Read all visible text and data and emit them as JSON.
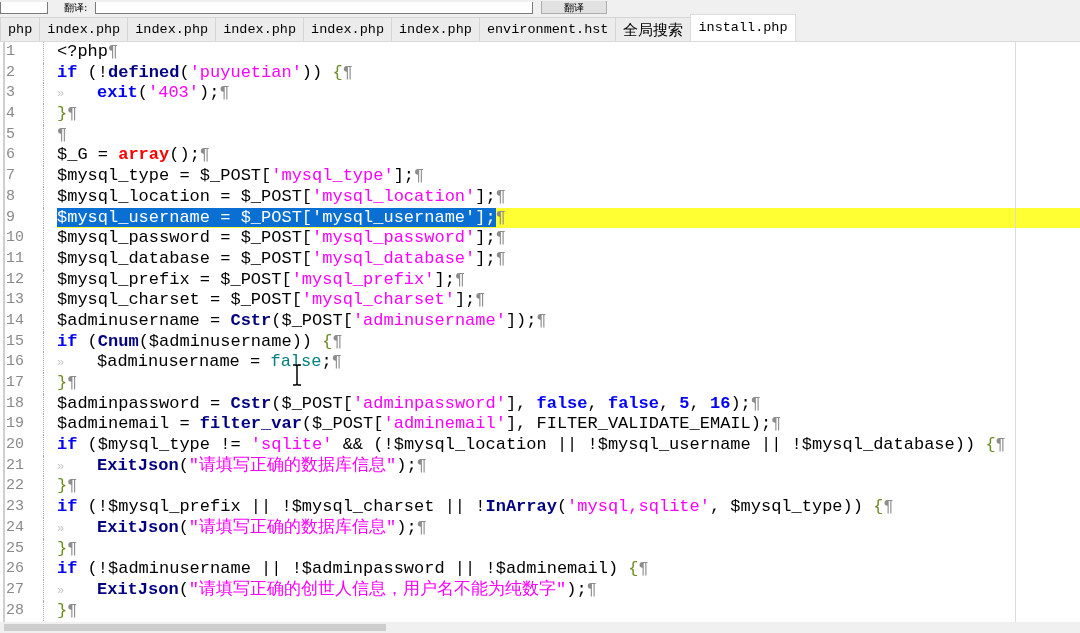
{
  "toolbar": {
    "label": "翻译:",
    "button": "翻译"
  },
  "tabs": [
    {
      "label": "php",
      "selected": false
    },
    {
      "label": "index.php",
      "selected": false
    },
    {
      "label": "index.php",
      "selected": false
    },
    {
      "label": "index.php",
      "selected": false
    },
    {
      "label": "index.php",
      "selected": false
    },
    {
      "label": "index.php",
      "selected": false
    },
    {
      "label": "environment.hst",
      "selected": false
    },
    {
      "label": "全局搜索",
      "selected": false
    },
    {
      "label": "install.php",
      "selected": true
    }
  ],
  "editor": {
    "lines": [
      {
        "number": "1",
        "current": false,
        "selected": false,
        "tokens": [
          {
            "kind": "plain",
            "text": "<?php"
          }
        ],
        "eol": "¶"
      },
      {
        "number": "2",
        "current": false,
        "selected": false,
        "tokens": [
          {
            "kind": "kw",
            "text": "if"
          },
          {
            "kind": "plain",
            "text": " (!"
          },
          {
            "kind": "fn",
            "text": "defined"
          },
          {
            "kind": "plain",
            "text": "("
          },
          {
            "kind": "str",
            "text": "'puyuetian'"
          },
          {
            "kind": "plain",
            "text": ")) "
          },
          {
            "kind": "brace",
            "text": "{"
          }
        ],
        "eol": "¶"
      },
      {
        "number": "3",
        "current": false,
        "selected": false,
        "tokens": [
          {
            "kind": "tab",
            "text": "»"
          },
          {
            "kind": "kw",
            "text": "exit"
          },
          {
            "kind": "plain",
            "text": "("
          },
          {
            "kind": "str",
            "text": "'403'"
          },
          {
            "kind": "plain",
            "text": ");"
          }
        ],
        "eol": "¶"
      },
      {
        "number": "4",
        "current": false,
        "selected": false,
        "tokens": [
          {
            "kind": "brace",
            "text": "}"
          }
        ],
        "eol": "¶"
      },
      {
        "number": "5",
        "current": false,
        "selected": false,
        "eol": "¶"
      },
      {
        "number": "6",
        "current": false,
        "selected": false,
        "tokens": [
          {
            "kind": "plain",
            "text": "$_G = "
          },
          {
            "kind": "red",
            "text": "array"
          },
          {
            "kind": "plain",
            "text": "();"
          }
        ],
        "eol": "¶"
      },
      {
        "number": "7",
        "current": false,
        "selected": false,
        "tokens": [
          {
            "kind": "plain",
            "text": "$mysql_type = $_POST["
          },
          {
            "kind": "str",
            "text": "'mysql_type'"
          },
          {
            "kind": "plain",
            "text": "];"
          }
        ],
        "eol": "¶"
      },
      {
        "number": "8",
        "current": false,
        "selected": false,
        "tokens": [
          {
            "kind": "plain",
            "text": "$mysql_location = $_POST["
          },
          {
            "kind": "str",
            "text": "'mysql_location'"
          },
          {
            "kind": "plain",
            "text": "];"
          }
        ],
        "eol": "¶"
      },
      {
        "number": "9",
        "current": true,
        "selected": true,
        "tokens": [
          {
            "kind": "plain",
            "text": "$mysql_username = $_POST["
          },
          {
            "kind": "str",
            "text": "'mysql_username'"
          },
          {
            "kind": "plain",
            "text": "];"
          }
        ],
        "eol": "¶"
      },
      {
        "number": "10",
        "current": false,
        "selected": false,
        "tokens": [
          {
            "kind": "plain",
            "text": "$mysql_password = $_POST["
          },
          {
            "kind": "str",
            "text": "'mysql_password'"
          },
          {
            "kind": "plain",
            "text": "];"
          }
        ],
        "eol": "¶"
      },
      {
        "number": "11",
        "current": false,
        "selected": false,
        "tokens": [
          {
            "kind": "plain",
            "text": "$mysql_database = $_POST["
          },
          {
            "kind": "str",
            "text": "'mysql_database'"
          },
          {
            "kind": "plain",
            "text": "];"
          }
        ],
        "eol": "¶"
      },
      {
        "number": "12",
        "current": false,
        "selected": false,
        "tokens": [
          {
            "kind": "plain",
            "text": "$mysql_prefix = $_POST["
          },
          {
            "kind": "str",
            "text": "'mysql_prefix'"
          },
          {
            "kind": "plain",
            "text": "];"
          }
        ],
        "eol": "¶"
      },
      {
        "number": "13",
        "current": false,
        "selected": false,
        "tokens": [
          {
            "kind": "plain",
            "text": "$mysql_charset = $_POST["
          },
          {
            "kind": "str",
            "text": "'mysql_charset'"
          },
          {
            "kind": "plain",
            "text": "];"
          }
        ],
        "eol": "¶"
      },
      {
        "number": "14",
        "current": false,
        "selected": false,
        "tokens": [
          {
            "kind": "plain",
            "text": "$adminusername = "
          },
          {
            "kind": "fn",
            "text": "Cstr"
          },
          {
            "kind": "plain",
            "text": "($_POST["
          },
          {
            "kind": "str",
            "text": "'adminusername'"
          },
          {
            "kind": "plain",
            "text": "]);"
          }
        ],
        "eol": "¶"
      },
      {
        "number": "15",
        "current": false,
        "selected": false,
        "tokens": [
          {
            "kind": "kw",
            "text": "if"
          },
          {
            "kind": "plain",
            "text": " ("
          },
          {
            "kind": "fn",
            "text": "Cnum"
          },
          {
            "kind": "plain",
            "text": "($adminusername)) "
          },
          {
            "kind": "brace",
            "text": "{"
          }
        ],
        "eol": "¶"
      },
      {
        "number": "16",
        "current": false,
        "selected": false,
        "tokens": [
          {
            "kind": "tab",
            "text": "»"
          },
          {
            "kind": "plain",
            "text": "$adminusername = "
          },
          {
            "kind": "const",
            "text": "false"
          },
          {
            "kind": "plain",
            "text": ";"
          }
        ],
        "eol": "¶"
      },
      {
        "number": "17",
        "current": false,
        "selected": false,
        "tokens": [
          {
            "kind": "brace",
            "text": "}"
          }
        ],
        "eol": "¶"
      },
      {
        "number": "18",
        "current": false,
        "selected": false,
        "tokens": [
          {
            "kind": "plain",
            "text": "$adminpassword = "
          },
          {
            "kind": "fn",
            "text": "Cstr"
          },
          {
            "kind": "plain",
            "text": "($_POST["
          },
          {
            "kind": "str",
            "text": "'adminpassword'"
          },
          {
            "kind": "plain",
            "text": "], "
          },
          {
            "kind": "kw",
            "text": "false"
          },
          {
            "kind": "plain",
            "text": ", "
          },
          {
            "kind": "kw",
            "text": "false"
          },
          {
            "kind": "plain",
            "text": ", "
          },
          {
            "kind": "kw",
            "text": "5"
          },
          {
            "kind": "plain",
            "text": ", "
          },
          {
            "kind": "kw",
            "text": "16"
          },
          {
            "kind": "plain",
            "text": ");"
          }
        ],
        "eol": "¶"
      },
      {
        "number": "19",
        "current": false,
        "selected": false,
        "tokens": [
          {
            "kind": "plain",
            "text": "$adminemail = "
          },
          {
            "kind": "fn",
            "text": "filter_var"
          },
          {
            "kind": "plain",
            "text": "($_POST["
          },
          {
            "kind": "str",
            "text": "'adminemail'"
          },
          {
            "kind": "plain",
            "text": "], FILTER_VALIDATE_EMAIL);"
          }
        ],
        "eol": "¶"
      },
      {
        "number": "20",
        "current": false,
        "selected": false,
        "tokens": [
          {
            "kind": "kw",
            "text": "if"
          },
          {
            "kind": "plain",
            "text": " ($mysql_type != "
          },
          {
            "kind": "str",
            "text": "'sqlite'"
          },
          {
            "kind": "plain",
            "text": " && (!$mysql_location || !$mysql_username || !$mysql_database)) "
          },
          {
            "kind": "brace",
            "text": "{"
          }
        ],
        "eol": "¶"
      },
      {
        "number": "21",
        "current": false,
        "selected": false,
        "tokens": [
          {
            "kind": "tab",
            "text": "»"
          },
          {
            "kind": "fn",
            "text": "ExitJson"
          },
          {
            "kind": "plain",
            "text": "("
          },
          {
            "kind": "str",
            "text": "\"请填写正确的数据库信息\""
          },
          {
            "kind": "plain",
            "text": ");"
          }
        ],
        "eol": "¶"
      },
      {
        "number": "22",
        "current": false,
        "selected": false,
        "tokens": [
          {
            "kind": "brace",
            "text": "}"
          }
        ],
        "eol": "¶"
      },
      {
        "number": "23",
        "current": false,
        "selected": false,
        "tokens": [
          {
            "kind": "kw",
            "text": "if"
          },
          {
            "kind": "plain",
            "text": " (!$mysql_prefix || !$mysql_charset || !"
          },
          {
            "kind": "fn",
            "text": "InArray"
          },
          {
            "kind": "plain",
            "text": "("
          },
          {
            "kind": "str",
            "text": "'mysql,sqlite'"
          },
          {
            "kind": "plain",
            "text": ", $mysql_type)) "
          },
          {
            "kind": "brace",
            "text": "{"
          }
        ],
        "eol": "¶"
      },
      {
        "number": "24",
        "current": false,
        "selected": false,
        "tokens": [
          {
            "kind": "tab",
            "text": "»"
          },
          {
            "kind": "fn",
            "text": "ExitJson"
          },
          {
            "kind": "plain",
            "text": "("
          },
          {
            "kind": "str",
            "text": "\"请填写正确的数据库信息\""
          },
          {
            "kind": "plain",
            "text": ");"
          }
        ],
        "eol": "¶"
      },
      {
        "number": "25",
        "current": false,
        "selected": false,
        "tokens": [
          {
            "kind": "brace",
            "text": "}"
          }
        ],
        "eol": "¶"
      },
      {
        "number": "26",
        "current": false,
        "selected": false,
        "tokens": [
          {
            "kind": "kw",
            "text": "if"
          },
          {
            "kind": "plain",
            "text": " (!$adminusername || !$adminpassword || !$adminemail) "
          },
          {
            "kind": "brace",
            "text": "{"
          }
        ],
        "eol": "¶"
      },
      {
        "number": "27",
        "current": false,
        "selected": false,
        "tokens": [
          {
            "kind": "tab",
            "text": "»"
          },
          {
            "kind": "fn",
            "text": "ExitJson"
          },
          {
            "kind": "plain",
            "text": "("
          },
          {
            "kind": "str",
            "text": "\"请填写正确的创世人信息，用户名不能为纯数字\""
          },
          {
            "kind": "plain",
            "text": ");"
          }
        ],
        "eol": "¶"
      },
      {
        "number": "28",
        "current": false,
        "selected": false,
        "tokens": [
          {
            "kind": "brace",
            "text": "}"
          }
        ],
        "eol": "¶"
      }
    ]
  }
}
